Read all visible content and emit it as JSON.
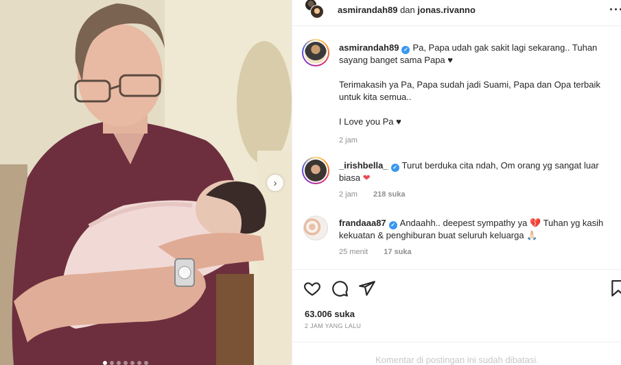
{
  "header": {
    "user1": "asmirandah89",
    "separator": "dan",
    "user2": "jonas.rivanno",
    "more_icon": "more-horizontal-icon"
  },
  "post": {
    "username": "asmirandah89",
    "verified": true,
    "caption_line1": "Pa, Papa udah gak sakit lagi sekarang.. Tuhan sayang banget sama Papa ♥",
    "caption_line2": "Terimakasih ya Pa, Papa sudah jadi Suami, Papa dan Opa terbaik untuk kita semua..",
    "caption_line3": "I Love you Pa ♥",
    "time": "2 jam"
  },
  "comments": [
    {
      "username": "_irishbella_",
      "verified": true,
      "text": "Turut berduka cita ndah, Om orang yg sangat luar biasa",
      "emoji": "❤",
      "time": "2 jam",
      "likes": "218 suka"
    },
    {
      "username": "frandaaa87",
      "verified": true,
      "text_before": "Andaahh.. deepest sympathy ya",
      "emoji1": "💔",
      "text_after": "Tuhan yg kasih kekuatan & penghiburan buat seluruh keluarga",
      "emoji2": "🙏🏻",
      "time": "25 menit",
      "likes": "17 suka"
    }
  ],
  "actions": {
    "like_icon": "heart-icon",
    "comment_icon": "comment-icon",
    "share_icon": "share-icon",
    "save_icon": "bookmark-icon"
  },
  "likes": "63.006 suka",
  "posted_ago": "2 JAM YANG LALU",
  "comments_disabled": "Komentar di postingan ini sudah dibatasi.",
  "carousel": {
    "next_icon": "chevron-right-icon",
    "slide_count": 7,
    "active_slide": 1
  }
}
